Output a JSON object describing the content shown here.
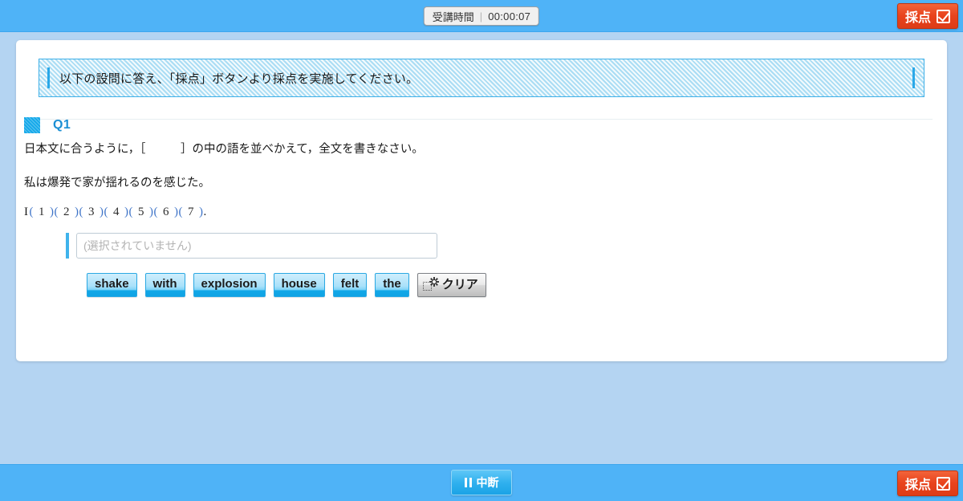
{
  "colors": {
    "bar_blue": "#4fb3f7",
    "page_bg": "#b4d4f2",
    "score_orange": "#e8431c",
    "accent_cyan": "#2aa8e8",
    "q_label_blue": "#1b8fd4"
  },
  "topbar": {
    "timer_label": "受講時間",
    "timer_separator": "|",
    "timer_value": "00:00:07",
    "score_button_label": "採点",
    "score_button_icon": "checked-checkbox-icon"
  },
  "banner": {
    "text": "以下の設問に答え、「採点」ボタンより採点を実施してください。"
  },
  "question": {
    "label": "Q1",
    "instruction": "日本文に合うように，［　　　］の中の語を並べかえて，全文を書きなさい。",
    "japanese_sentence": "私は爆発で家が揺れるのを感じた。",
    "blanks_lead": "I",
    "blank_numbers": [
      "1",
      "2",
      "3",
      "4",
      "5",
      "6",
      "7"
    ],
    "blanks_trailing": ".",
    "answer_placeholder": "(選択されていません)",
    "answer_value": "",
    "word_choices": [
      "shake",
      "with",
      "explosion",
      "house",
      "felt",
      "the"
    ],
    "clear_button_label": "クリア",
    "clear_button_icon": "eraser-sparkle-icon"
  },
  "bottombar": {
    "pause_button_label": "中断",
    "pause_button_icon": "pause-icon",
    "score_button_label": "採点",
    "score_button_icon": "checked-checkbox-icon"
  }
}
